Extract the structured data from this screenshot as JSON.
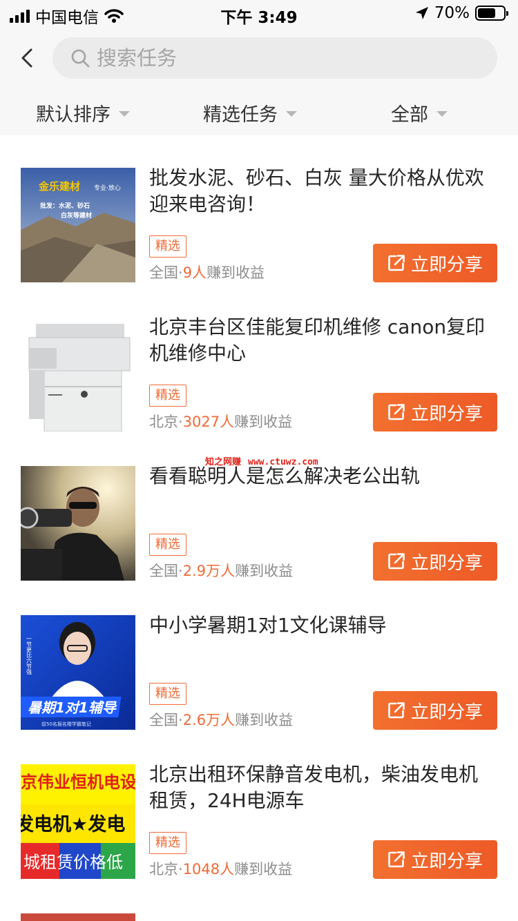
{
  "status_bar": {
    "carrier": "中国电信",
    "time": "下午 3:49",
    "battery": "70%",
    "battery_level": 0.7
  },
  "search": {
    "placeholder": "搜索任务"
  },
  "filters": [
    {
      "label": "默认排序"
    },
    {
      "label": "精选任务"
    },
    {
      "label": "全部"
    }
  ],
  "items": [
    {
      "title": "批发水泥、砂石、白灰 量大价格从优欢迎来电咨询！",
      "tag": "精选",
      "region": "全国",
      "count": "9人",
      "suffix": "赚到收益",
      "button": "立即分享",
      "thumb": "cement-thumbnail"
    },
    {
      "title": "北京丰台区佳能复印机维修 canon复印机维修中心",
      "tag": "精选",
      "region": "北京",
      "count": "3027人",
      "suffix": "赚到收益",
      "button": "立即分享",
      "thumb": "copier-thumbnail"
    },
    {
      "title": "看看聪明人是怎么解决老公出轨",
      "tag": "精选",
      "region": "全国",
      "count": "2.9万人",
      "suffix": "赚到收益",
      "button": "立即分享",
      "thumb": "camera-man-thumbnail"
    },
    {
      "title": "中小学暑期1对1文化课辅导",
      "tag": "精选",
      "region": "全国",
      "count": "2.6万人",
      "suffix": "赚到收益",
      "button": "立即分享",
      "thumb": "tutoring-thumbnail"
    },
    {
      "title": "北京出租环保静音发电机，柴油发电机租赁，24H电源车",
      "tag": "精选",
      "region": "北京",
      "count": "1048人",
      "suffix": "赚到收益",
      "button": "立即分享",
      "thumb": "generator-thumbnail"
    }
  ],
  "thumb_text": {
    "cement_brand": "金乐建材",
    "cement_sub": "专业·放心",
    "cement_line1": "批发：水泥、砂石",
    "cement_line2": "白灰等建材",
    "tutor_banner": "暑期1对1辅导",
    "tutor_side": "一节更比六节强",
    "tutor_small": "前50名报名赠学霸笔记",
    "gen_line1": "京伟业恒机电设",
    "gen_line2": "发电机★发电",
    "gen_line3": "城租赁价格低"
  },
  "watermark": {
    "name": "知之网赚",
    "url": "www.ctuwz.com"
  },
  "colors": {
    "accent": "#ef6a36",
    "button_start": "#f2702f",
    "button_end": "#ee5a27"
  }
}
